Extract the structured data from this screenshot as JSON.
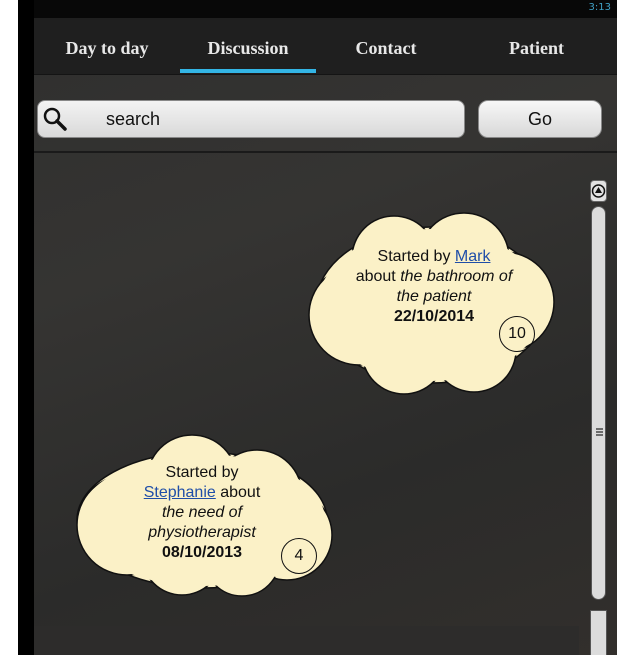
{
  "status_bar": {
    "time": "3:13"
  },
  "tabs": [
    {
      "label": "Day to day",
      "selected": false
    },
    {
      "label": "Discussion",
      "selected": true
    },
    {
      "label": "Contact",
      "selected": false
    },
    {
      "label": "Patient",
      "selected": false
    }
  ],
  "search": {
    "placeholder": "search",
    "value": "",
    "go_label": "Go"
  },
  "discussions": [
    {
      "started_by": "Started by",
      "author": "Mark",
      "about_prefix": "about",
      "topic": "the bathroom of the patient",
      "date": "22/10/2014",
      "count": "10"
    },
    {
      "started_by": "Started by",
      "author": "Stephanie",
      "about_prefix": "about",
      "topic": "the need of physiotherapist",
      "date": "08/10/2013",
      "count": "4"
    }
  ],
  "colors": {
    "accent": "#33b5e5",
    "cloud": "#fbf1c7",
    "link": "#1f4ea8"
  }
}
